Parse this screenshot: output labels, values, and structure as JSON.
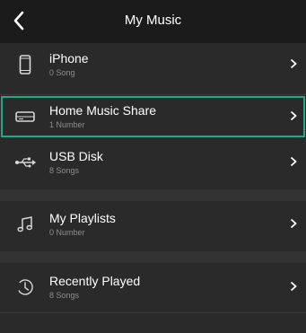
{
  "header": {
    "title": "My Music",
    "back_icon": "chevron-left-icon"
  },
  "items": [
    {
      "id": "iphone",
      "name": "iPhone",
      "subtitle": "0 Song",
      "icon": "phone-icon",
      "selected": false
    },
    {
      "id": "home-music-share",
      "name": "Home Music Share",
      "subtitle": "1 Number",
      "icon": "hard-drive-icon",
      "selected": true
    },
    {
      "id": "usb-disk",
      "name": "USB Disk",
      "subtitle": "8 Songs",
      "icon": "usb-icon",
      "selected": false
    },
    {
      "id": "my-playlists",
      "name": "My Playlists",
      "subtitle": "0 Number",
      "icon": "music-note-icon",
      "selected": false
    },
    {
      "id": "recently-played",
      "name": "Recently Played",
      "subtitle": "8 Songs",
      "icon": "clock-icon",
      "selected": false
    }
  ],
  "colors": {
    "background": "#2a2a2a",
    "header": "#1b1b1b",
    "selection": "#1fa98a",
    "subtitle": "#8e8e8e"
  }
}
